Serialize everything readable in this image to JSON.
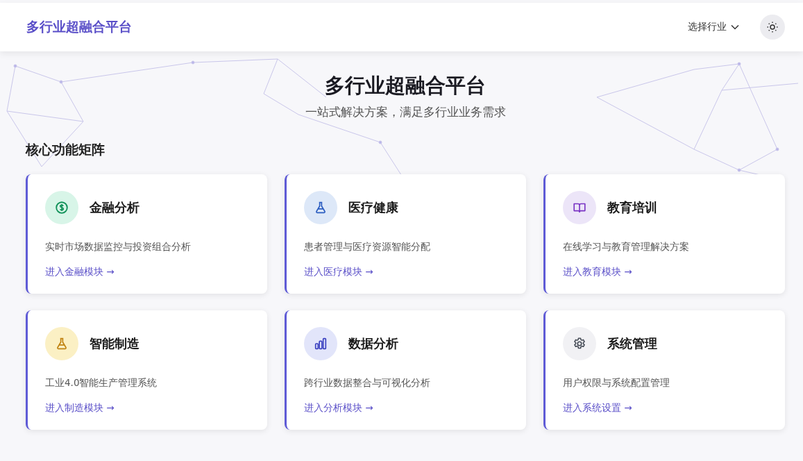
{
  "header": {
    "logo": "多行业超融合平台",
    "industry_select": "选择行业"
  },
  "hero": {
    "title": "多行业超融合平台",
    "subtitle": "一站式解决方案，满足多行业业务需求"
  },
  "section_title": "核心功能矩阵",
  "cards": [
    {
      "kind": "finance",
      "title": "金融分析",
      "description": "实时市场数据监控与投资组合分析",
      "link": "进入金融模块 →"
    },
    {
      "kind": "medical",
      "title": "医疗健康",
      "description": "患者管理与医疗资源智能分配",
      "link": "进入医疗模块 →"
    },
    {
      "kind": "education",
      "title": "教育培训",
      "description": "在线学习与教育管理解决方案",
      "link": "进入教育模块 →"
    },
    {
      "kind": "manufacturing",
      "title": "智能制造",
      "description": "工业4.0智能生产管理系统",
      "link": "进入制造模块 →"
    },
    {
      "kind": "analytics",
      "title": "数据分析",
      "description": "跨行业数据整合与可视化分析",
      "link": "进入分析模块 →"
    },
    {
      "kind": "system",
      "title": "系统管理",
      "description": "用户权限与系统配置管理",
      "link": "进入系统设置 →"
    }
  ]
}
